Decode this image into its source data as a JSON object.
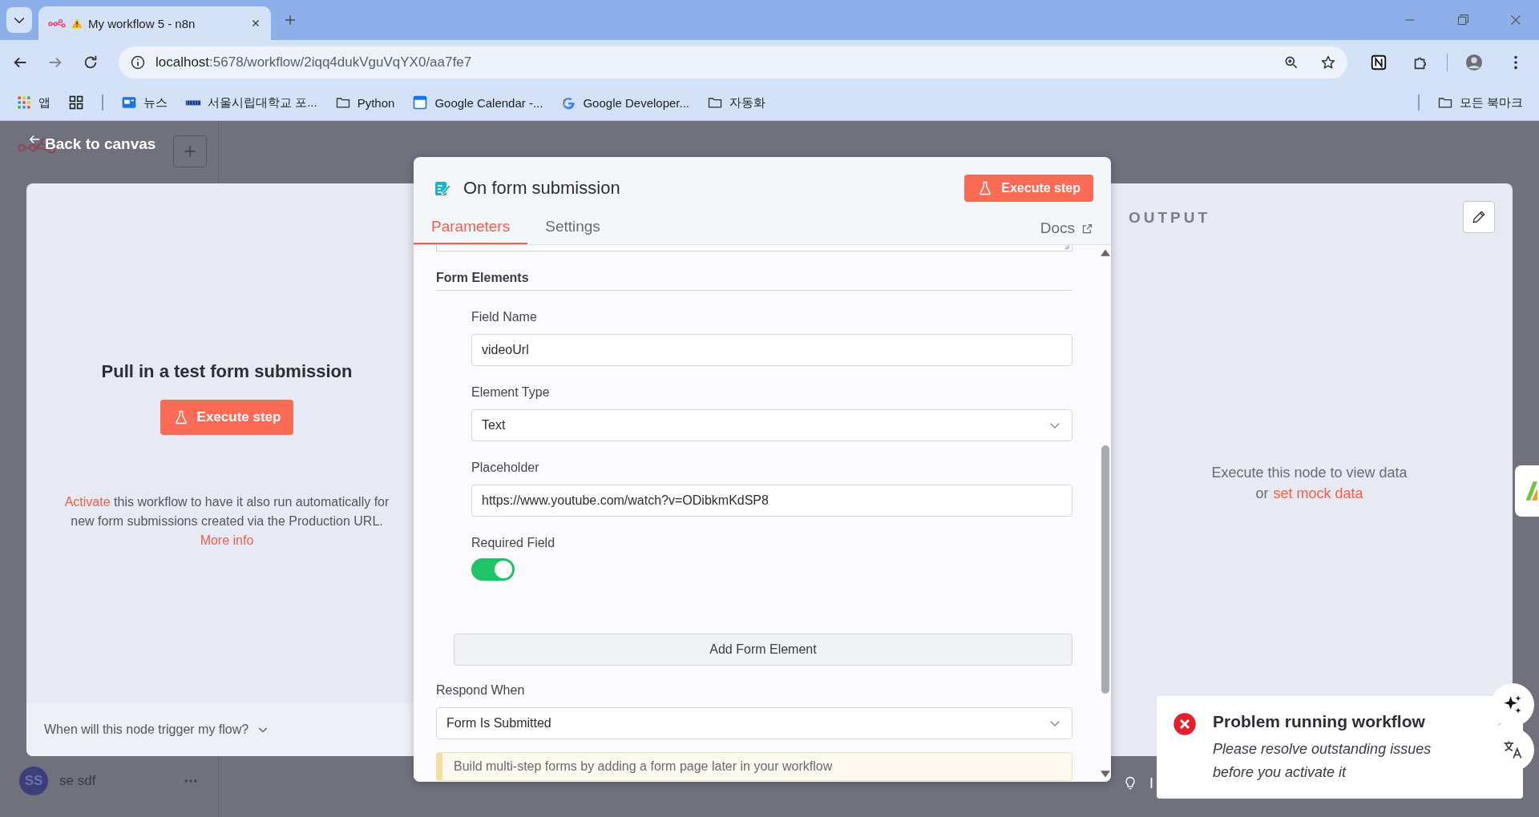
{
  "browser": {
    "tab_title": "My workflow 5 - n8n",
    "url_host": "localhost",
    "url_path": ":5678/workflow/2iqq4dukVguVqYX0/aa7fe7",
    "bookmarks": [
      {
        "kind": "apps",
        "label": "앱"
      },
      {
        "kind": "grid"
      },
      {
        "kind": "news",
        "label": "뉴스"
      },
      {
        "kind": "site",
        "label": "서울시립대학교 포..."
      },
      {
        "kind": "folder",
        "label": "Python"
      },
      {
        "kind": "calendar",
        "label": "Google Calendar -..."
      },
      {
        "kind": "google",
        "label": "Google Developer..."
      },
      {
        "kind": "folder",
        "label": "자동화"
      }
    ],
    "all_bookmarks": "모든 북마크"
  },
  "sidebar": {
    "user_initials": "SS",
    "user_name": "se sdf"
  },
  "back_link": "Back to canvas",
  "input_panel": {
    "title": "Pull in a test form submission",
    "button": "Execute step",
    "note_link": "Activate",
    "note_text": " this workflow to have it also run automatically for new form submissions created via the Production URL. ",
    "more_link": "More info",
    "footer": "When will this node trigger my flow?",
    "footer_expanded": false
  },
  "node": {
    "title": "On form submission",
    "button": "Execute step",
    "tabs": [
      {
        "label": "Parameters",
        "selected": true
      },
      {
        "label": "Settings",
        "selected": false
      }
    ],
    "docs": "Docs",
    "section": "Form Elements",
    "fields": [
      {
        "kind": "input",
        "label": "Field Name",
        "value": "videoUrl"
      },
      {
        "kind": "select",
        "label": "Element Type",
        "value": "Text"
      },
      {
        "kind": "input",
        "label": "Placeholder",
        "value": "https://www.youtube.com/watch?v=ODibkmKdSP8"
      },
      {
        "kind": "toggle",
        "label": "Required Field",
        "on": true
      }
    ],
    "add_button": "Add Form Element",
    "respond_label": "Respond When",
    "respond_value": "Form Is Submitted",
    "notice": "Build multi-step forms by adding a form page later in your workflow"
  },
  "output": {
    "title": "OUTPUT",
    "empty": "Execute this node to view data",
    "or": "or",
    "mock_link": "set mock data",
    "hint": "I"
  },
  "toast": {
    "title": "Problem running workflow",
    "message": "Please resolve outstanding issues before you activate it"
  }
}
